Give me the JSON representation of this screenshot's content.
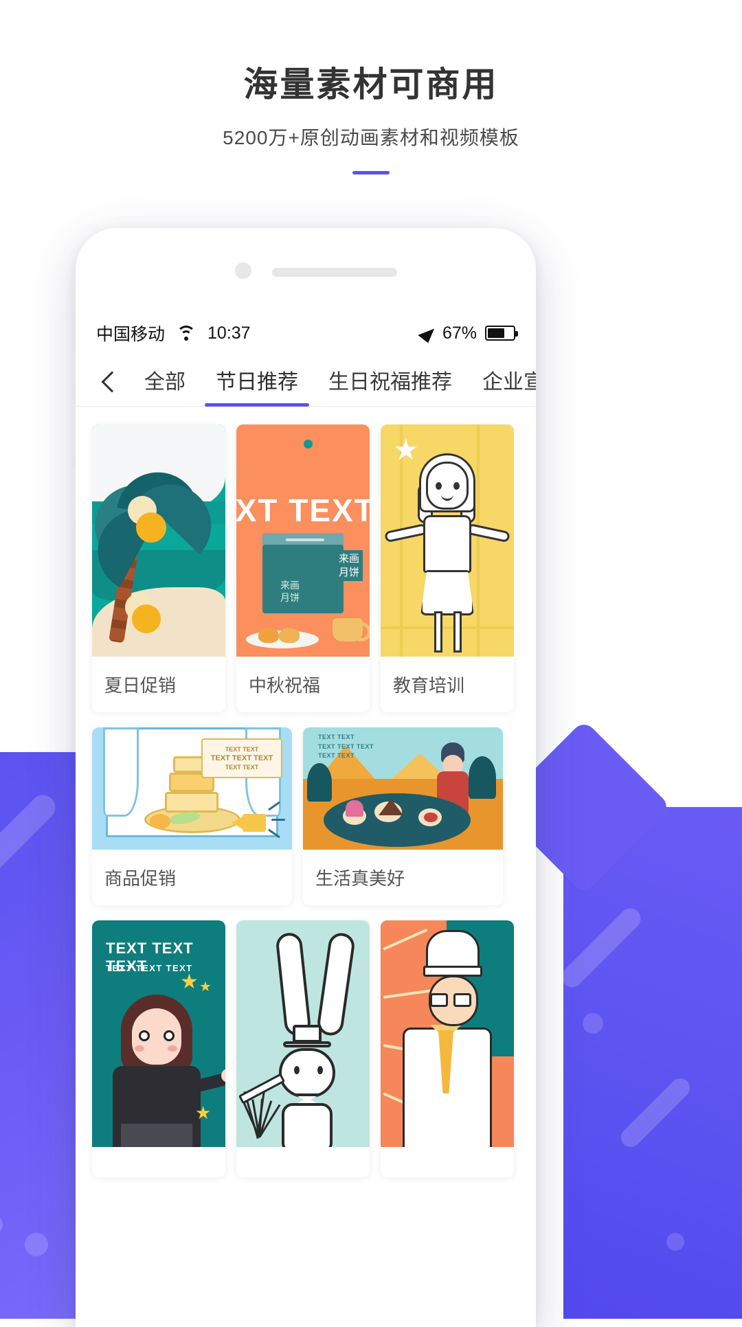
{
  "header": {
    "title": "海量素材可商用",
    "subtitle": "5200万+原创动画素材和视频模板"
  },
  "phone": {
    "statusbar": {
      "carrier": "中国移动",
      "wifi_icon": "wifi-icon",
      "time": "10:37",
      "location_icon": "location-arrow-icon",
      "battery_percent": "67%",
      "battery_icon": "battery-icon",
      "battery_level": 67
    },
    "navbar": {
      "back_icon": "chevron-left-icon",
      "tabs": [
        {
          "label": "全部",
          "active": false
        },
        {
          "label": "节日推荐",
          "active": true
        },
        {
          "label": "生日祝福推荐",
          "active": false
        },
        {
          "label": "企业宣传",
          "active": false
        }
      ]
    },
    "grid": {
      "rows": [
        {
          "cards": [
            {
              "caption": "夏日促销"
            },
            {
              "caption": "中秋祝福",
              "overlay_text": "EXT TEXT",
              "box_label": "来画\n月饼",
              "box_label2": "来画\n月饼"
            },
            {
              "caption": "教育培训"
            }
          ]
        },
        {
          "cards": [
            {
              "caption": "商品促销",
              "tag_line1": "TEXT TEXT",
              "tag_line2": "TEXT TEXT TEXT",
              "tag_line3": "TEXT TEXT"
            },
            {
              "caption": "生活真美好",
              "overlay_text": "TEXT TEXT\nTEXT TEXT TEXT\nTEXT TEXT"
            }
          ]
        },
        {
          "cards": [
            {
              "caption": "",
              "overlay_title": "TEXT TEXT TEXT",
              "overlay_sub": "TEXT TEXT TEXT"
            },
            {
              "caption": ""
            },
            {
              "caption": ""
            }
          ]
        }
      ]
    }
  },
  "colors": {
    "accent": "#5a52f0",
    "title_text": "#333333",
    "sub_text": "#4a4a4a",
    "card_caption": "#555555",
    "background": "#ffffff",
    "card1_bg": "#0aa79b",
    "card2_bg": "#fb8f5e",
    "card3_bg": "#f7d765",
    "card4_bg": "#a9ddf5",
    "card5_bg": "#8fd4d8",
    "card6_bg": "#0e7d7d",
    "card7_bg": "#bfe5e0",
    "card8_bg": "#0e7d7d"
  }
}
